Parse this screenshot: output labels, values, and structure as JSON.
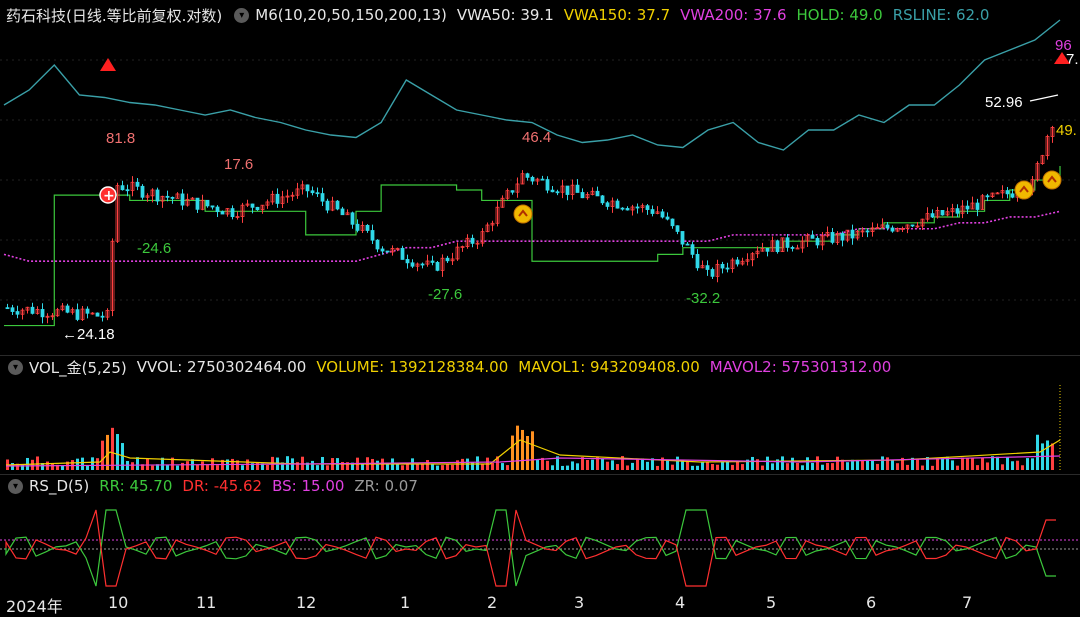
{
  "main_header": {
    "title": "药石科技(日线.等比前复权.对数)",
    "indicators": [
      {
        "text": "M6(10,20,50,150,200,13)",
        "color": "#e6e6e6"
      },
      {
        "text": "VWA50: 39.1",
        "color": "#e6e6e6"
      },
      {
        "text": "VWA150: 37.7",
        "color": "#f0d000"
      },
      {
        "text": "VWA200: 37.6",
        "color": "#e040e0"
      },
      {
        "text": "HOLD: 49.0",
        "color": "#3cc83c"
      },
      {
        "text": "RSLINE: 62.0",
        "color": "#3aa0a8"
      }
    ]
  },
  "vol_header": {
    "title": "VOL_金(5,25)",
    "indicators": [
      {
        "text": "VVOL: 2750302464.00",
        "color": "#e6e6e6"
      },
      {
        "text": "VOLUME: 1392128384.00",
        "color": "#f0d000"
      },
      {
        "text": "MAVOL1: 943209408.00",
        "color": "#f0d000"
      },
      {
        "text": "MAVOL2: 575301312.00",
        "color": "#e040e0"
      }
    ]
  },
  "rs_header": {
    "title": "RS_D(5)",
    "indicators": [
      {
        "text": "RR: 45.70",
        "color": "#3cc83c"
      },
      {
        "text": "DR: -45.62",
        "color": "#ff3030"
      },
      {
        "text": "BS: 15.00",
        "color": "#e040e0"
      },
      {
        "text": "ZR: 0.07",
        "color": "#9a9a9a"
      }
    ]
  },
  "x_axis": {
    "labels": [
      "2024年",
      "10",
      "11",
      "12",
      "1",
      "2",
      "3",
      "4",
      "5",
      "6",
      "7"
    ]
  },
  "annotations": [
    {
      "text": "81.8",
      "color": "#f07070"
    },
    {
      "text": "17.6",
      "color": "#f07070"
    },
    {
      "text": "46.4",
      "color": "#f07070"
    },
    {
      "text": "-24.6",
      "color": "#3cc83c"
    },
    {
      "text": "-27.6",
      "color": "#3cc83c"
    },
    {
      "text": "-32.2",
      "color": "#3cc83c"
    },
    {
      "text": "←24.18",
      "color": "#ffffff"
    },
    {
      "text": "52.96",
      "color": "#ffffff"
    },
    {
      "text": "96",
      "color": "#e040e0"
    },
    {
      "text": "7.",
      "color": "#ffffff"
    },
    {
      "text": "49.",
      "color": "#f0d000"
    }
  ],
  "colors": {
    "up": "#ff4040",
    "down": "#30d8e8",
    "rsline": "#3aa0a8",
    "hold": "#3cc83c",
    "vwa": "#e040e0",
    "mavol1": "#f0d000",
    "bg": "#000000"
  },
  "chart_data": {
    "type": "candlestick",
    "title": "药石科技(日线.等比前复权.对数)",
    "x_labels": [
      "2024年",
      "10",
      "11",
      "12",
      "1",
      "2",
      "3",
      "4",
      "5",
      "6",
      "7"
    ],
    "y_scale": "log",
    "price_ylim": [
      22,
      90
    ],
    "marked_values": {
      "high": 52.96,
      "low": 24.18
    },
    "rsline": [
      62,
      68,
      78,
      66,
      65,
      63,
      62,
      60,
      58,
      60,
      57,
      55,
      52,
      50,
      49,
      55,
      72,
      66,
      60,
      58,
      56,
      55,
      50,
      47,
      48,
      50,
      46,
      45,
      52,
      55,
      47,
      44,
      52,
      52,
      58,
      55,
      62,
      62,
      70,
      80,
      84,
      88,
      96
    ],
    "hold": [
      24,
      24,
      43,
      43,
      43,
      42,
      42,
      42,
      40,
      40,
      40,
      40,
      36,
      36,
      40,
      45,
      45,
      45,
      44,
      42,
      42,
      32,
      32,
      32,
      32,
      32,
      33,
      34,
      34,
      34,
      34,
      35,
      35,
      36,
      37,
      38,
      38,
      39,
      40,
      42,
      44,
      46,
      49
    ],
    "vwa200": [
      33,
      32,
      32,
      32,
      32,
      32,
      32,
      32,
      32,
      32,
      32,
      32,
      32,
      32,
      32,
      33,
      34,
      34,
      35,
      35,
      35,
      35,
      35,
      35,
      35,
      35,
      35,
      35,
      35,
      36,
      36,
      36,
      36,
      36,
      37,
      37,
      37,
      37,
      38,
      38,
      39,
      39,
      40
    ],
    "rs_series": {
      "RR_last": 45.7,
      "DR_last": -45.62,
      "BS": 15.0,
      "ZR": 0.07
    }
  }
}
